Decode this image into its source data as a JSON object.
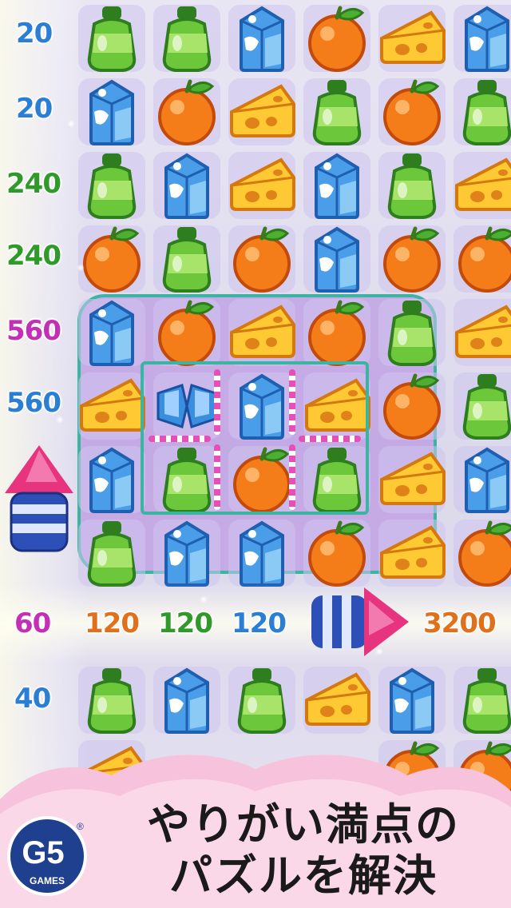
{
  "caption": {
    "line1": "やりがい満点の",
    "line2": "パズルを解決"
  },
  "logo": {
    "mark": "G5",
    "registered": "®",
    "subtitle": "GAMES"
  },
  "grid": [
    [
      "",
      "bottle",
      "bottle",
      "milk",
      "orange",
      "cheese",
      "milk"
    ],
    [
      "",
      "milk",
      "orange",
      "cheese",
      "bottle",
      "orange",
      "bottle"
    ],
    [
      "",
      "bottle",
      "milk",
      "cheese",
      "milk",
      "bottle",
      "cheese"
    ],
    [
      "",
      "orange",
      "bottle",
      "orange",
      "milk",
      "orange",
      "orange"
    ],
    [
      "",
      "milk",
      "orange",
      "cheese",
      "orange",
      "bottle",
      "cheese"
    ],
    [
      "",
      "cheese",
      "candy",
      "milk",
      "cheese",
      "orange",
      "bottle"
    ],
    [
      "",
      "milk",
      "bottle",
      "orange",
      "bottle",
      "cheese",
      "milk"
    ],
    [
      "",
      "bottle",
      "milk",
      "milk",
      "orange",
      "cheese",
      "orange"
    ],
    [
      "",
      "",
      "",
      "",
      "",
      "",
      ""
    ],
    [
      "",
      "bottle",
      "milk",
      "bottle",
      "cheese",
      "milk",
      "bottle"
    ],
    [
      "",
      "cheese",
      "",
      "",
      "",
      "orange",
      "orange"
    ]
  ],
  "scores": [
    {
      "text": "20",
      "color": "#2a7fd4"
    },
    {
      "text": "20",
      "color": "#2a7fd4"
    },
    {
      "text": "240",
      "color": "#2f9a2a"
    },
    {
      "text": "240",
      "color": "#2f9a2a"
    },
    {
      "text": "560",
      "color": "#c42fb8"
    },
    {
      "text": "560",
      "color": "#2a7fd4"
    },
    {
      "text": "60",
      "color": "#c42fb8"
    },
    {
      "text": "120",
      "color": "#e0701a"
    },
    {
      "text": "120",
      "color": "#2f9a2a"
    },
    {
      "text": "120",
      "color": "#2a7fd4"
    },
    {
      "text": "3200",
      "color": "#e0701a"
    },
    {
      "text": "40",
      "color": "#2a7fd4"
    }
  ],
  "colors": {
    "cage_border": "#3bb5a1",
    "bar_pink": "#e64fb8",
    "cloud_pink": "#f7c3dc",
    "logo_blue": "#1f3f8f"
  }
}
